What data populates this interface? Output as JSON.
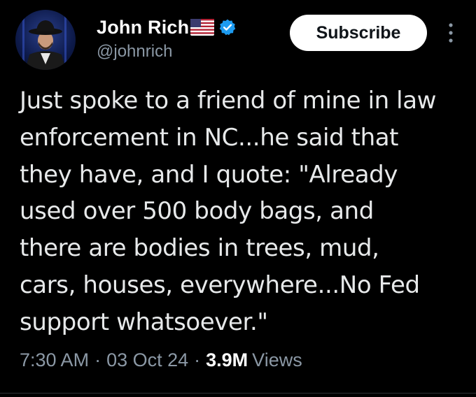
{
  "user": {
    "display_name": "John Rich",
    "handle": "@johnrich",
    "flag_icon": "us-flag-icon",
    "verified_icon": "verified-badge-icon",
    "verified_color": "#1d9bf0"
  },
  "actions": {
    "subscribe_label": "Subscribe",
    "more_icon": "more-options-icon"
  },
  "tweet": {
    "text": "Just spoke to a friend of mine in law\nenforcement in NC...he said that\nthey have, and I quote: \"Already\nused over 500 body bags, and\nthere are bodies in trees, mud,\ncars, houses, everywhere...No Fed\nsupport whatsoever.\""
  },
  "meta": {
    "time": "7:30 AM",
    "separator": "·",
    "date": "03 Oct 24",
    "views_count": "3.9M",
    "views_label": "Views"
  },
  "colors": {
    "background": "#000000",
    "primary_text": "#e7e9ea",
    "secondary_text": "#8b98a5",
    "button_bg": "#ffffff"
  }
}
